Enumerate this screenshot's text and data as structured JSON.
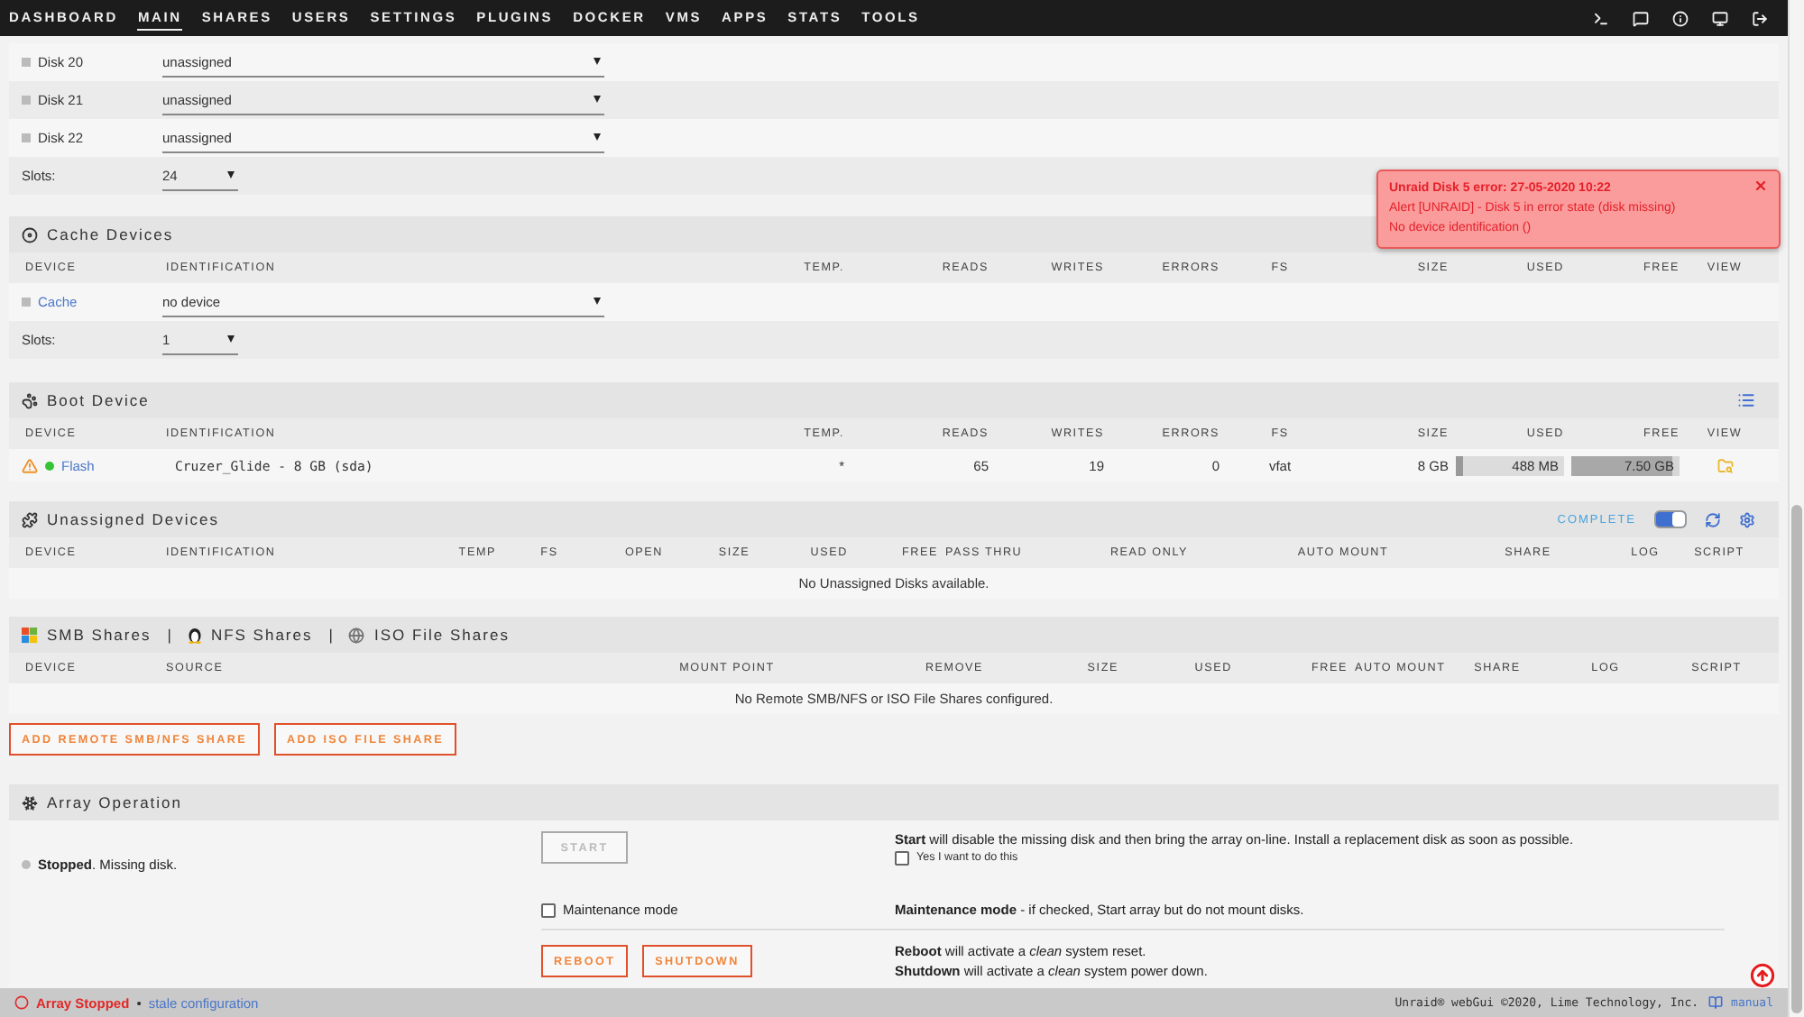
{
  "nav": {
    "items": [
      {
        "label": "DASHBOARD",
        "selected": false
      },
      {
        "label": "MAIN",
        "selected": true
      },
      {
        "label": "SHARES",
        "selected": false
      },
      {
        "label": "USERS",
        "selected": false
      },
      {
        "label": "SETTINGS",
        "selected": false
      },
      {
        "label": "PLUGINS",
        "selected": false
      },
      {
        "label": "DOCKER",
        "selected": false
      },
      {
        "label": "VMS",
        "selected": false
      },
      {
        "label": "APPS",
        "selected": false
      },
      {
        "label": "STATS",
        "selected": false
      },
      {
        "label": "TOOLS",
        "selected": false
      }
    ]
  },
  "array_disks": {
    "rows": [
      {
        "name": "Disk 20",
        "assignment": "unassigned"
      },
      {
        "name": "Disk 21",
        "assignment": "unassigned"
      },
      {
        "name": "Disk 22",
        "assignment": "unassigned"
      }
    ],
    "slots_label": "Slots:",
    "slots": "24"
  },
  "cache": {
    "title": "Cache Devices",
    "columns": [
      "DEVICE",
      "IDENTIFICATION",
      "TEMP.",
      "READS",
      "WRITES",
      "ERRORS",
      "FS",
      "SIZE",
      "USED",
      "FREE",
      "VIEW"
    ],
    "rows": [
      {
        "name": "Cache",
        "assignment": "no device"
      }
    ],
    "slots_label": "Slots:",
    "slots": "1"
  },
  "boot": {
    "title": "Boot Device",
    "columns": [
      "DEVICE",
      "IDENTIFICATION",
      "TEMP.",
      "READS",
      "WRITES",
      "ERRORS",
      "FS",
      "SIZE",
      "USED",
      "FREE",
      "VIEW"
    ],
    "rows": [
      {
        "warning": true,
        "color": "#35c435",
        "name": "Flash",
        "identification": "Cruzer_Glide - 8 GB (sda)",
        "temp": "*",
        "reads": "65",
        "writes": "19",
        "errors": "0",
        "fs": "vfat",
        "size": "8 GB",
        "used": {
          "text": "488 MB",
          "level": 0.06
        },
        "free": {
          "text": "7.50 GB",
          "level": 0.94
        }
      }
    ]
  },
  "unassigned": {
    "title": "Unassigned Devices",
    "toggle": {
      "label": "COMPLETE",
      "on": true
    },
    "columns": [
      "DEVICE",
      "IDENTIFICATION",
      "TEMP",
      "FS",
      "OPEN",
      "SIZE",
      "USED",
      "FREE",
      "PASS THRU",
      "READ ONLY",
      "AUTO MOUNT",
      "SHARE",
      "LOG",
      "SCRIPT"
    ],
    "empty_message": "No Unassigned Disks available."
  },
  "remote_shares": {
    "titles": [
      "SMB Shares",
      "NFS Shares",
      "ISO File Shares"
    ],
    "separator": "|",
    "columns": [
      "DEVICE",
      "SOURCE",
      "MOUNT POINT",
      "REMOVE",
      "SIZE",
      "USED",
      "FREE",
      "AUTO MOUNT",
      "SHARE",
      "LOG",
      "SCRIPT"
    ],
    "empty_message": "No Remote SMB/NFS or ISO File Shares configured.",
    "buttons": [
      "ADD REMOTE SMB/NFS SHARE",
      "ADD ISO FILE SHARE"
    ]
  },
  "array_operation": {
    "title": "Array Operation",
    "status": "**Stopped**. Missing disk.",
    "start": {
      "label": "START",
      "disabled": true
    },
    "start_text": "**Start** will disable the missing disk and then bring the array on-line. Install a replacement disk as soon as possible.",
    "confirm": {
      "label": "Yes I want to do this",
      "checked": false
    },
    "maintenance": {
      "label": "Maintenance mode",
      "checked": false
    },
    "maintenance_text": "**Maintenance mode** - if checked, Start array but do not mount disks.",
    "buttons": [
      "REBOOT",
      "SHUTDOWN"
    ],
    "power_texts": [
      "**Reboot** will activate a *clean* system reset.",
      "**Shutdown** will activate a *clean* system power down."
    ]
  },
  "notification": {
    "title": "Unraid Disk 5 error: 27-05-2020 10:22",
    "lines": [
      "Alert [UNRAID] - Disk 5 in error state (disk missing)",
      "No device identification ()"
    ]
  },
  "footer": {
    "status": "Array Stopped",
    "separator": "•",
    "link": "stale configuration",
    "copyright": "Unraid® webGui ©2020, Lime Technology, Inc.",
    "manual": "manual"
  }
}
